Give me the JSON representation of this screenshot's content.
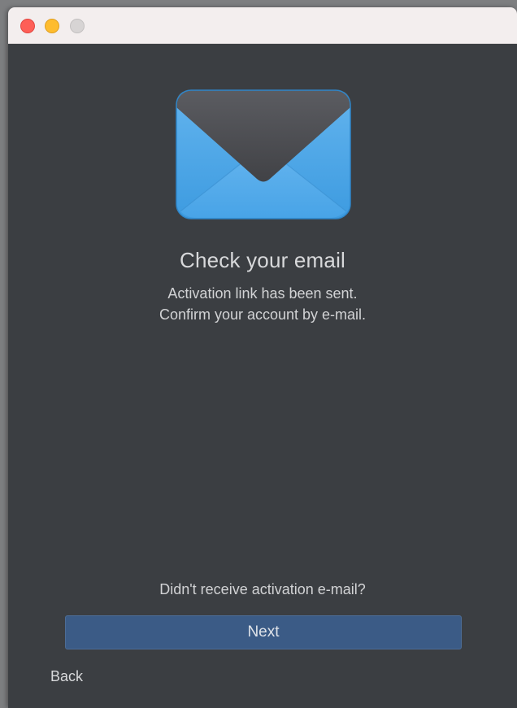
{
  "window": {
    "controls": [
      "close",
      "minimize",
      "zoom"
    ]
  },
  "hero": {
    "icon": "envelope-icon",
    "title": "Check your email",
    "message_line1": "Activation link has been sent.",
    "message_line2": "Confirm your account by e-mail."
  },
  "footer": {
    "resend_link": "Didn't receive activation e-mail?",
    "next_label": "Next",
    "back_label": "Back"
  },
  "colors": {
    "window_bg": "#3b3e42",
    "primary_button": "#3b5b86",
    "envelope_blue": "#5aa9e6",
    "envelope_flap": "#4a4b4f"
  }
}
